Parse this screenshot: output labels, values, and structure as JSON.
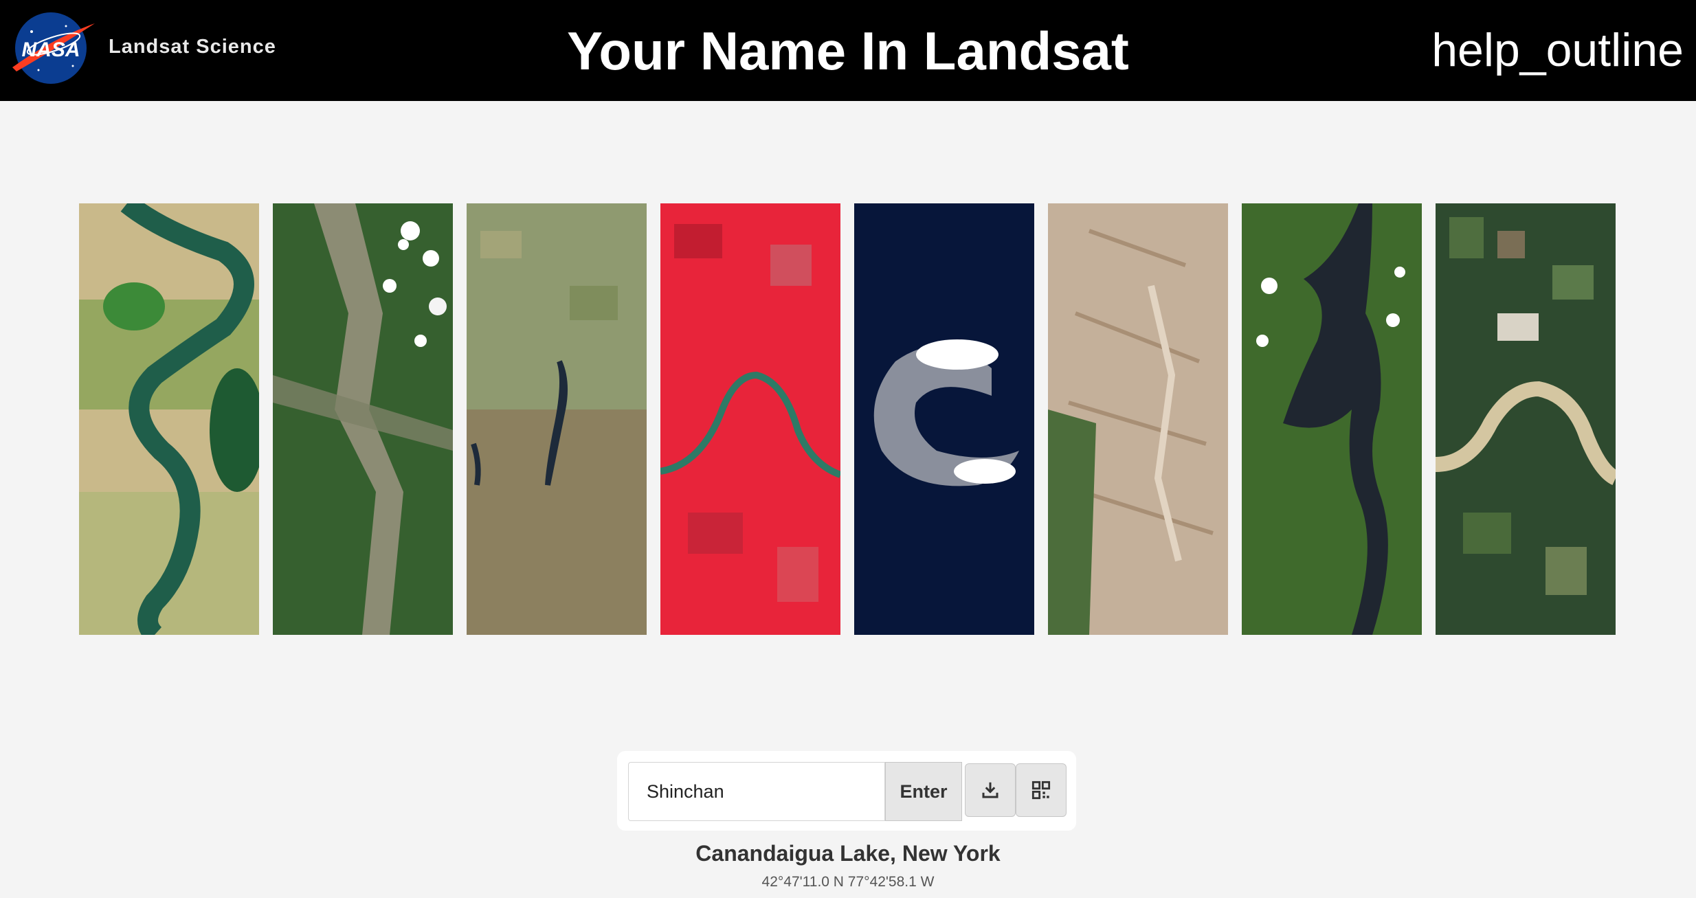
{
  "header": {
    "logo_text": "NASA",
    "brand": "Landsat Science",
    "title": "Your Name In Landsat",
    "help_icon_text": "help_outline"
  },
  "letters": [
    {
      "name": "strip-1",
      "scene": "green river meander over tan floodplain"
    },
    {
      "name": "strip-2",
      "scene": "forested hills with scattered clouds"
    },
    {
      "name": "strip-3",
      "scene": "farmland with narrow dark lake"
    },
    {
      "name": "strip-4",
      "scene": "false-color red fields with river"
    },
    {
      "name": "strip-5",
      "scene": "crescent island in dark ocean"
    },
    {
      "name": "strip-6",
      "scene": "tan desert dunes with green edge"
    },
    {
      "name": "strip-7",
      "scene": "forest with long dark lake"
    },
    {
      "name": "strip-8",
      "scene": "patchwork fields with meandering river"
    }
  ],
  "search": {
    "value": "Shinchan",
    "enter_label": "Enter",
    "download_icon": "download-icon",
    "qr_icon": "qr-code-icon"
  },
  "location": {
    "name": "Canandaigua Lake, New York",
    "coords": "42°47'11.0 N 77°42'58.1 W"
  },
  "colors": {
    "header_bg": "#000000",
    "page_bg": "#f4f4f4",
    "button_bg": "#e6e6e6"
  }
}
